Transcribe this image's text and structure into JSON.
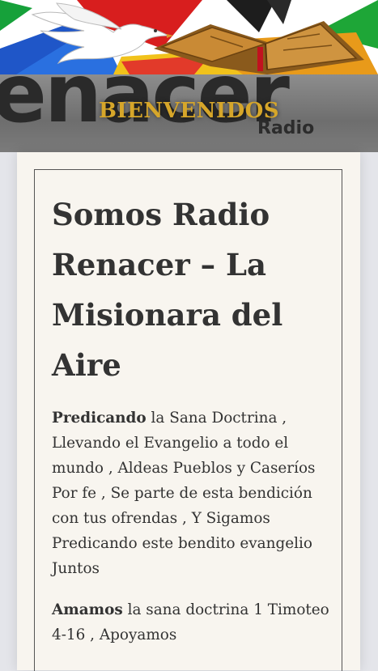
{
  "header": {
    "logo_word": "enacer",
    "logo_sub": "Radio",
    "welcome": "BIENVENIDOS"
  },
  "post": {
    "title": "Somos Radio Renacer – La Misionara del Aire",
    "p1_strong": "Predicando",
    "p1_text": " la Sana Doctrina , Llevando el Evangelio a todo el mundo , Aldeas Pueblos y Caseríos Por fe , Se parte de esta bendición con tus ofrendas , Y Sigamos Predicando este bendito evangelio Juntos",
    "p2_strong": "Amamos",
    "p2_text": " la sana doctrina 1 Timoteo 4-16 , Apoyamos"
  },
  "colors": {
    "welcome_text": "#d6a62a",
    "card_background": "#f8f5ef",
    "page_background": "#e4e5ea",
    "body_text": "#333333"
  },
  "icons": [
    "dove-icon",
    "open-bible-icon"
  ]
}
